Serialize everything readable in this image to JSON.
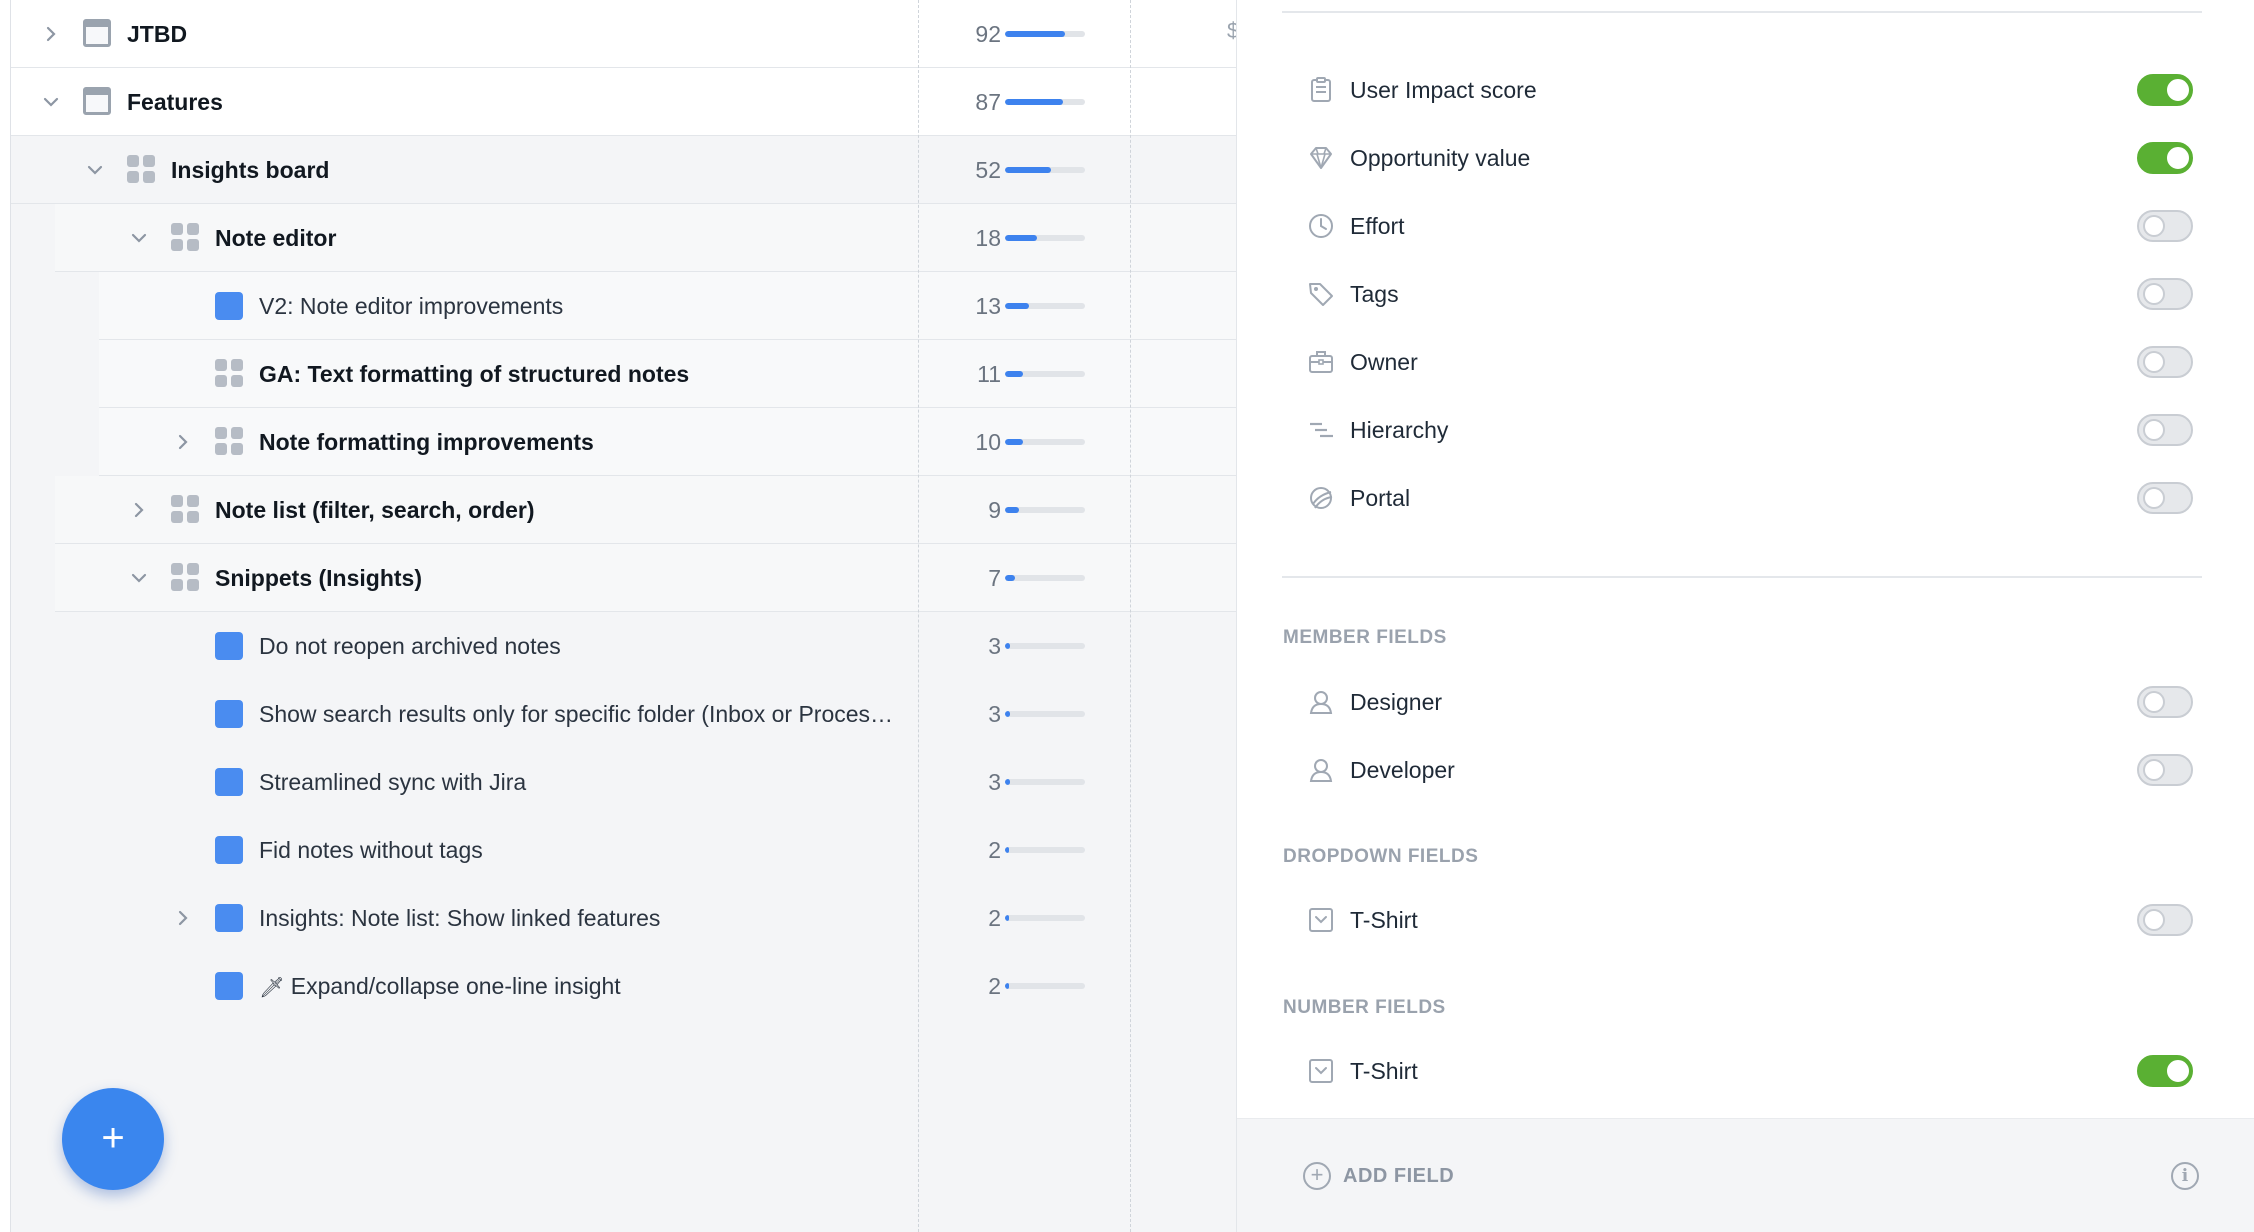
{
  "tree": {
    "rows": [
      {
        "label": "JTBD",
        "score": "92",
        "fill": 0.75
      },
      {
        "label": "Features",
        "score": "87",
        "fill": 0.72
      },
      {
        "label": "Insights board",
        "score": "52",
        "fill": 0.58
      },
      {
        "label": "Note editor",
        "score": "18",
        "fill": 0.4
      },
      {
        "label": "V2: Note editor improvements",
        "score": "13",
        "fill": 0.3
      },
      {
        "label": "GA: Text formatting of structured notes",
        "score": "11",
        "fill": 0.22
      },
      {
        "label": "Note formatting improvements",
        "score": "10",
        "fill": 0.22
      },
      {
        "label": "Note list (filter, search, order)",
        "score": "9",
        "fill": 0.17
      },
      {
        "label": "Snippets (Insights)",
        "score": "7",
        "fill": 0.13
      },
      {
        "label": "Do not reopen archived notes",
        "score": "3",
        "fill": 0.06
      },
      {
        "label": "Show search results only for specific folder (Inbox or Proces…",
        "score": "3",
        "fill": 0.06
      },
      {
        "label": "Streamlined sync with Jira",
        "score": "3",
        "fill": 0.06
      },
      {
        "label": "Fid notes without tags",
        "score": "2",
        "fill": 0.05
      },
      {
        "label": "Insights: Note list: Show linked features",
        "score": "2",
        "fill": 0.05
      },
      {
        "label": "Expand/collapse one-line insight",
        "emoji": "🗡",
        "score": "2",
        "fill": 0.05
      }
    ],
    "column_cut_text": "$",
    "fab_label": "+"
  },
  "panel": {
    "fields": [
      {
        "label": "User Impact score",
        "icon": "clipboard-icon",
        "on": true
      },
      {
        "label": "Opportunity value",
        "icon": "diamond-icon",
        "on": true
      },
      {
        "label": "Effort",
        "icon": "clock-icon",
        "on": false
      },
      {
        "label": "Tags",
        "icon": "tag-icon",
        "on": false
      },
      {
        "label": "Owner",
        "icon": "briefcase-icon",
        "on": false
      },
      {
        "label": "Hierarchy",
        "icon": "hierarchy-icon",
        "on": false
      },
      {
        "label": "Portal",
        "icon": "portal-icon",
        "on": false
      }
    ],
    "member_fields_title": "MEMBER FIELDS",
    "member_fields": [
      {
        "label": "Designer",
        "icon": "person-icon",
        "on": false
      },
      {
        "label": "Developer",
        "icon": "person-icon",
        "on": false
      }
    ],
    "dropdown_fields_title": "DROPDOWN FIELDS",
    "dropdown_fields": [
      {
        "label": "T-Shirt",
        "icon": "dropdown-icon",
        "on": false
      }
    ],
    "number_fields_title": "NUMBER FIELDS",
    "number_fields": [
      {
        "label": "T-Shirt",
        "icon": "dropdown-icon",
        "on": true
      }
    ],
    "add_field_label": "ADD FIELD",
    "info_icon": "i"
  },
  "colors": {
    "accent_blue": "#3d82ee",
    "toggle_on": "#5ab033"
  }
}
